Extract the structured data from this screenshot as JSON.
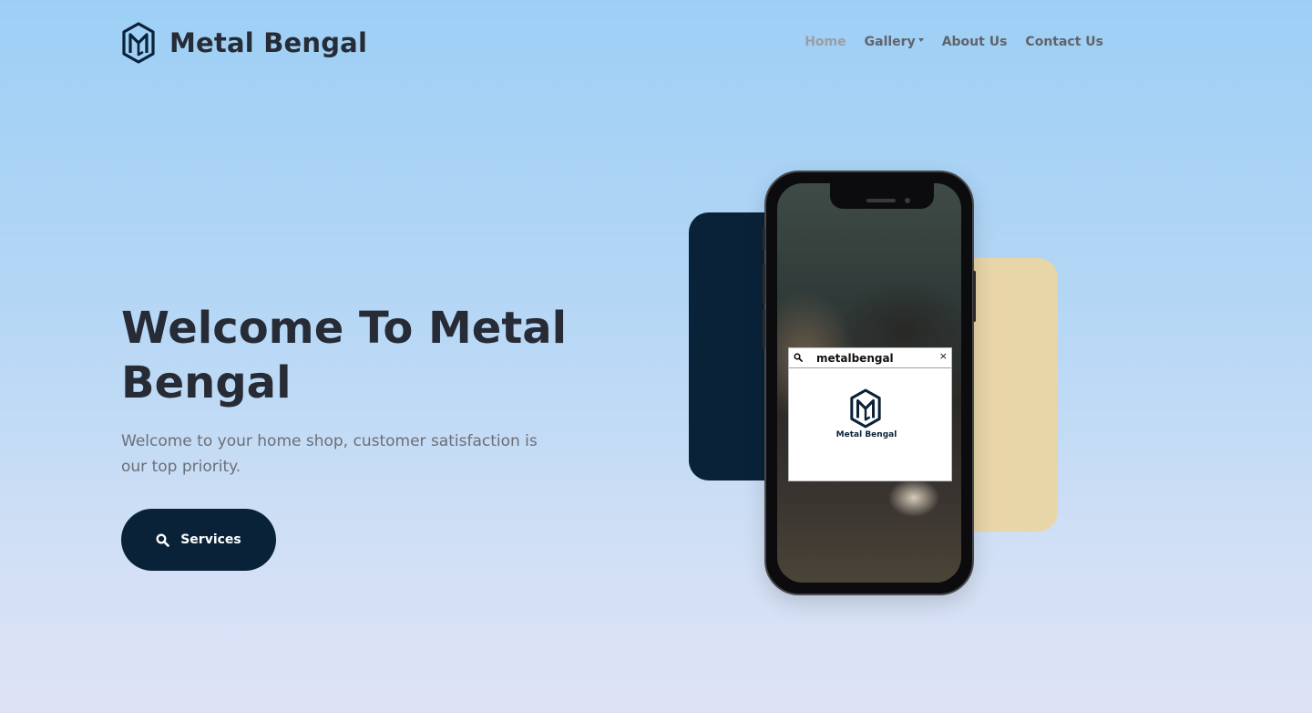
{
  "brand": {
    "name": "Metal Bengal",
    "logo_icon": "mb-monogram-icon"
  },
  "nav": {
    "items": [
      {
        "label": "Home",
        "active": true
      },
      {
        "label": "Gallery",
        "dropdown": true
      },
      {
        "label": "About Us"
      },
      {
        "label": "Contact Us"
      }
    ]
  },
  "hero": {
    "title": "Welcome To Metal Bengal",
    "subtitle": "Welcome to your home shop, customer satisfaction is our top priority.",
    "button_label": "Services",
    "button_icon": "search-icon"
  },
  "phone": {
    "popup": {
      "query": "metalbengal",
      "close_glyph": "×",
      "logo_caption": "Metal Bengal"
    }
  },
  "colors": {
    "navy": "#0a2238",
    "tan": "#e8d5a8",
    "text_dark": "#262b36",
    "text_muted": "#6b6f78",
    "nav_active": "#9a9da3"
  }
}
